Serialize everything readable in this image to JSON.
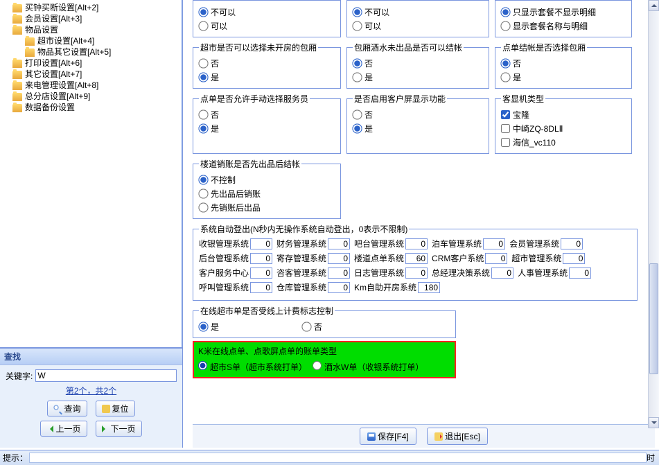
{
  "tree": [
    {
      "label": "买钟买断设置[Alt+2]",
      "indent": 0
    },
    {
      "label": "会员设置[Alt+3]",
      "indent": 0
    },
    {
      "label": "物品设置",
      "indent": 0
    },
    {
      "label": "超市设置[Alt+4]",
      "indent": 1
    },
    {
      "label": "物品其它设置[Alt+5]",
      "indent": 1
    },
    {
      "label": "打印设置[Alt+6]",
      "indent": 0
    },
    {
      "label": "其它设置[Alt+7]",
      "indent": 0
    },
    {
      "label": "来电管理设置[Alt+8]",
      "indent": 0
    },
    {
      "label": "总分店设置[Alt+9]",
      "indent": 0
    },
    {
      "label": "数据备份设置",
      "indent": 0
    }
  ],
  "find": {
    "title": "查找",
    "keyword_label": "关键字:",
    "keyword_value": "W",
    "info": "第2个，共2个",
    "btn_query": "查询",
    "btn_reset": "复位",
    "btn_prev": "上一页",
    "btn_next": "下一页"
  },
  "top_opts": {
    "a": [
      "不可以",
      "可以"
    ],
    "a_sel": 0,
    "b": [
      "不可以",
      "可以"
    ],
    "b_sel": 0,
    "c": [
      "只显示套餐不显示明细",
      "显示套餐名称与明细"
    ],
    "c_sel": 0
  },
  "row2": {
    "t1": "超市是否可以选择未开房的包厢",
    "o1": [
      "否",
      "是"
    ],
    "s1": 1,
    "t2": "包厢酒水未出品是否可以结帐",
    "o2": [
      "否",
      "是"
    ],
    "s2": 0,
    "t3": "点单结帐是否选择包厢",
    "o3": [
      "否",
      "是"
    ],
    "s3": 0
  },
  "row3": {
    "t1": "点单是否允许手动选择服务员",
    "o1": [
      "否",
      "是"
    ],
    "s1": 1,
    "t2": "是否启用客户屏显示功能",
    "o2": [
      "否",
      "是"
    ],
    "s2": 1,
    "t3": "客显机类型",
    "o3": [
      "宝隆",
      "中崎ZQ-8DLⅡ",
      "海信_vc110"
    ],
    "s3": 0
  },
  "row4": {
    "t1": "楼道销账是否先出品后结帐",
    "o1": [
      "不控制",
      "先出品后销账",
      "先销账后出品"
    ],
    "s1": 0
  },
  "autologout": {
    "title": "系统自动登出(N秒内无操作系统自动登出，0表示不限制)",
    "rows": [
      [
        {
          "l": "收银管理系统",
          "v": "0"
        },
        {
          "l": "财务管理系统",
          "v": "0"
        },
        {
          "l": "吧台管理系统",
          "v": "0"
        },
        {
          "l": "泊车管理系统",
          "v": "0"
        },
        {
          "l": "会员管理系统",
          "v": "0"
        }
      ],
      [
        {
          "l": "后台管理系统",
          "v": "0"
        },
        {
          "l": "寄存管理系统",
          "v": "0"
        },
        {
          "l": "楼道点单系统",
          "v": "60"
        },
        {
          "l": "CRM客户系统",
          "v": "0"
        },
        {
          "l": "超市管理系统",
          "v": "0"
        }
      ],
      [
        {
          "l": "客户服务中心",
          "v": "0"
        },
        {
          "l": "咨客管理系统",
          "v": "0"
        },
        {
          "l": "日志管理系统",
          "v": "0"
        },
        {
          "l": "总经理决策系统",
          "v": "0"
        },
        {
          "l": "人事管理系统",
          "v": "0"
        }
      ],
      [
        {
          "l": "呼叫管理系统",
          "v": "0"
        },
        {
          "l": "仓库管理系统",
          "v": "0"
        },
        {
          "l": "Km自助开房系统",
          "v": "180"
        }
      ]
    ]
  },
  "online": {
    "title": "在线超市单是否受线上计费标志控制",
    "opts": [
      "是",
      "否"
    ],
    "sel": 0
  },
  "kmi": {
    "title": "K米在线点单、点歌屏点单的账单类型",
    "opts": [
      "超市S单（超市系统打单）",
      "酒水W单（收银系统打单）"
    ],
    "sel": 0
  },
  "buttons": {
    "save": "保存[F4]",
    "exit": "退出[Esc]"
  },
  "status": {
    "label": "提示：",
    "time": "时"
  }
}
